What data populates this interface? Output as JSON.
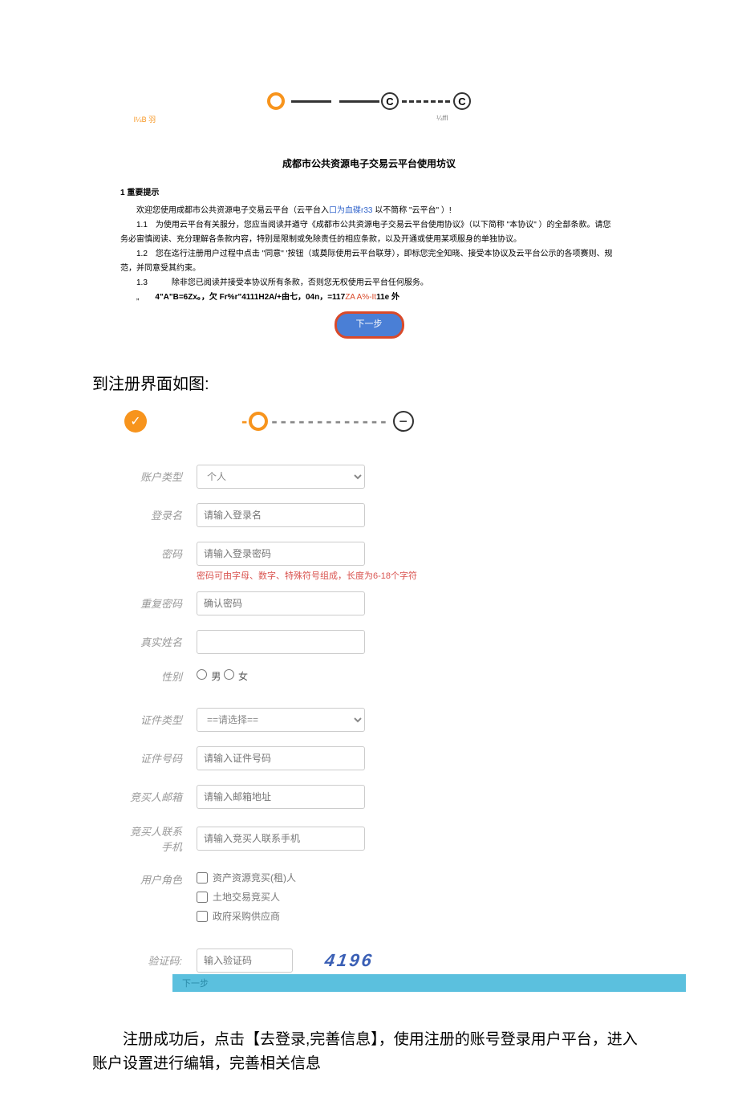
{
  "top_stepper": {
    "label_left": "I¼B 羽",
    "label_right": "¼ffl",
    "c_glyph": "C"
  },
  "agreement": {
    "title": "成都市公共资源电子交易云平台使用坊议",
    "section1_head": "1 重要提示",
    "welcome_a": "欢迎您使用成都市公共资源电子交易云平台（云平台入",
    "welcome_link": "口为血碟r33",
    "welcome_b": " 以不筒称 \"云平台\" ）!",
    "p11": "1.1　为使用云平台有关服分，您应当阅读并遒守《成都市公共资源电子交易云平台使用协议》（以下简称 \"本协议\" ）的全部条款。请您务必宙慎阅读、充分理解各条款内容，特别是限制或免除责任的相应条款，以及开通或使用某项服身的单独协议。",
    "p12": "1.2　您在迄行注册用户过程中点击 \"同意\" '按钮（或奠际使用云平台联芽），即标您完全知晓、接受本协议及云平台公示的各项赛则、规范，并同意受其约束。",
    "p13": "1.3　　　除非您已阅读并接受本协议所有条款，否则您无权使用云平台任何服务。",
    "p_misc_a": "4\"A\"B=6Zx。，欠 Fr%r\"4111H2A/+由七，04n，=117",
    "p_misc_b": "ZA A%-It",
    "p_misc_c": "11e 外",
    "next_btn": "下一步"
  },
  "section_heading": "到注册界面如图:",
  "form": {
    "account_type_label": "账户类型",
    "account_type_value": "个人",
    "login_label": "登录名",
    "login_ph": "请输入登录名",
    "pwd_label": "密码",
    "pwd_ph": "请输入登录密码",
    "pwd_hint": "密码可由字母、数字、特殊符号组成，长度为6-18个字符",
    "pwd2_label": "重复密码",
    "pwd2_ph": "确认密码",
    "realname_label": "真实姓名",
    "gender_label": "性别",
    "gender_m": "男",
    "gender_f": "女",
    "idtype_label": "证件类型",
    "idtype_value": "==请选择==",
    "idno_label": "证件号码",
    "idno_ph": "请输入证件号码",
    "email_label": "竞买人邮箱",
    "email_ph": "请输入邮箱地址",
    "phone_label": "竞买人联系手机",
    "phone_ph": "请输入竞买人联系手机",
    "role_label": "用户角色",
    "role_opt1": "资产资源竞买(租)人",
    "role_opt2": "土地交易竞买人",
    "role_opt3": "政府采购供应商",
    "captcha_label": "验证码:",
    "captcha_ph": "输入验证码",
    "captcha_value": "4196",
    "next_bar": "下一步"
  },
  "reg_stepper": {
    "check": "✓",
    "minus": "−"
  },
  "bottom_paragraph": "注册成功后，点击【去登录,完善信息】，使用注册的账号登录用户平台，进入账户设置进行编辑，完善相关信息"
}
